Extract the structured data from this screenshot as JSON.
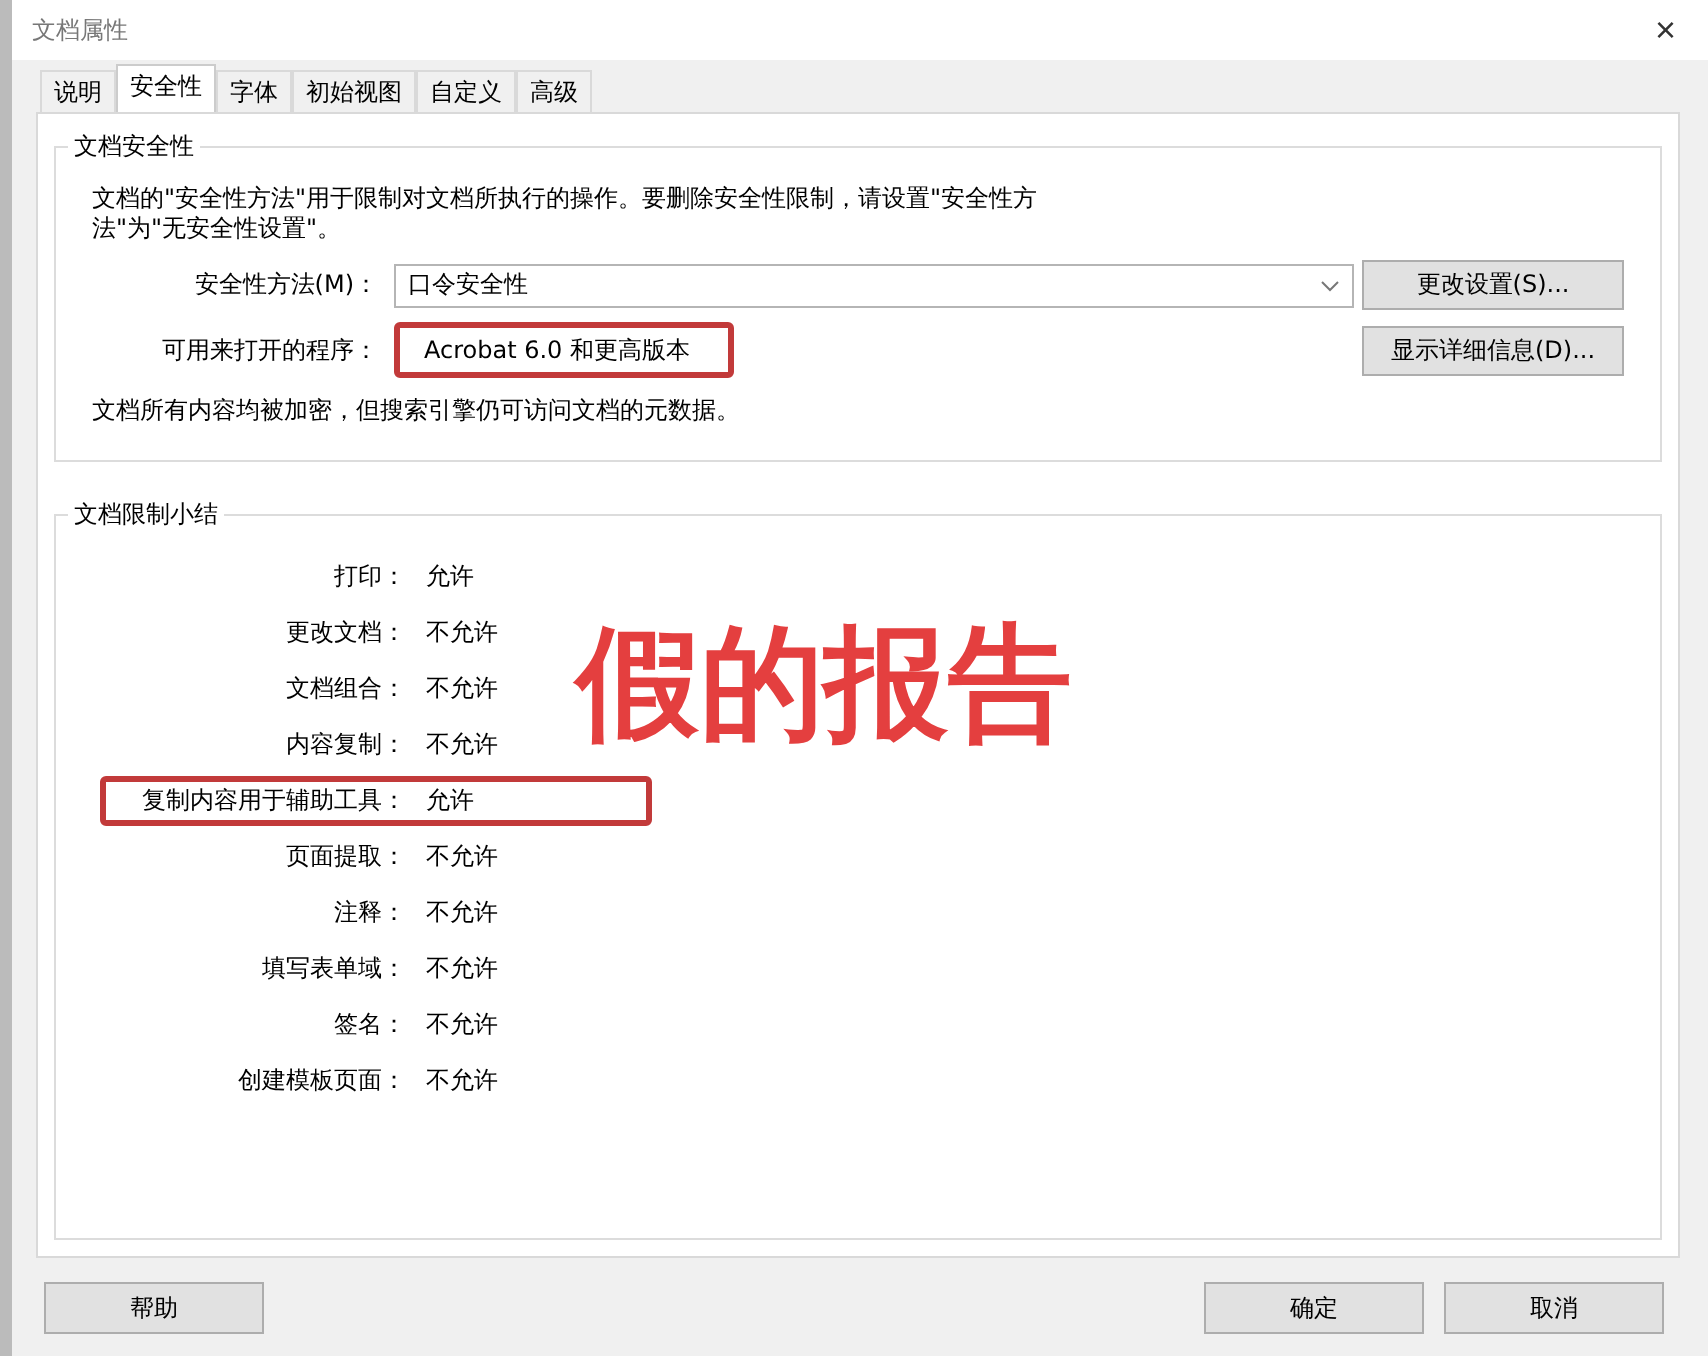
{
  "window": {
    "title": "文档属性",
    "close": "×"
  },
  "tabs": [
    {
      "label": "说明",
      "selected": false
    },
    {
      "label": "安全性",
      "selected": true
    },
    {
      "label": "字体",
      "selected": false
    },
    {
      "label": "初始视图",
      "selected": false
    },
    {
      "label": "自定义",
      "selected": false
    },
    {
      "label": "高级",
      "selected": false
    }
  ],
  "security": {
    "title": "文档安全性",
    "description": "文档的\"安全性方法\"用于限制对文档所执行的操作。要删除安全性限制，请设置\"安全性方法\"为\"无安全性设置\"。",
    "method": {
      "label": "安全性方法(M)：",
      "value": "口令安全性",
      "button": "更改设置(S)..."
    },
    "program": {
      "label": "可用来打开的程序：",
      "value": "Acrobat 6.0 和更高版本",
      "highlighted": true,
      "button": "显示详细信息(D)..."
    },
    "note": "文档所有内容均被加密，但搜索引擎仍可访问文档的元数据。"
  },
  "summary": {
    "title": "文档限制小结",
    "rows": [
      {
        "label": "打印：",
        "value": "允许",
        "highlighted": false
      },
      {
        "label": "更改文档：",
        "value": "不允许",
        "highlighted": false
      },
      {
        "label": "文档组合：",
        "value": "不允许",
        "highlighted": false
      },
      {
        "label": "内容复制：",
        "value": "不允许",
        "highlighted": false
      },
      {
        "label": "复制内容用于辅助工具：",
        "value": "允许",
        "highlighted": true
      },
      {
        "label": "页面提取：",
        "value": "不允许",
        "highlighted": false
      },
      {
        "label": "注释：",
        "value": "不允许",
        "highlighted": false
      },
      {
        "label": "填写表单域：",
        "value": "不允许",
        "highlighted": false
      },
      {
        "label": "签名：",
        "value": "不允许",
        "highlighted": false
      },
      {
        "label": "创建模板页面：",
        "value": "不允许",
        "highlighted": false
      }
    ]
  },
  "annotation": "假的报告",
  "buttons": {
    "help": "帮助",
    "ok": "确定",
    "cancel": "取消"
  }
}
